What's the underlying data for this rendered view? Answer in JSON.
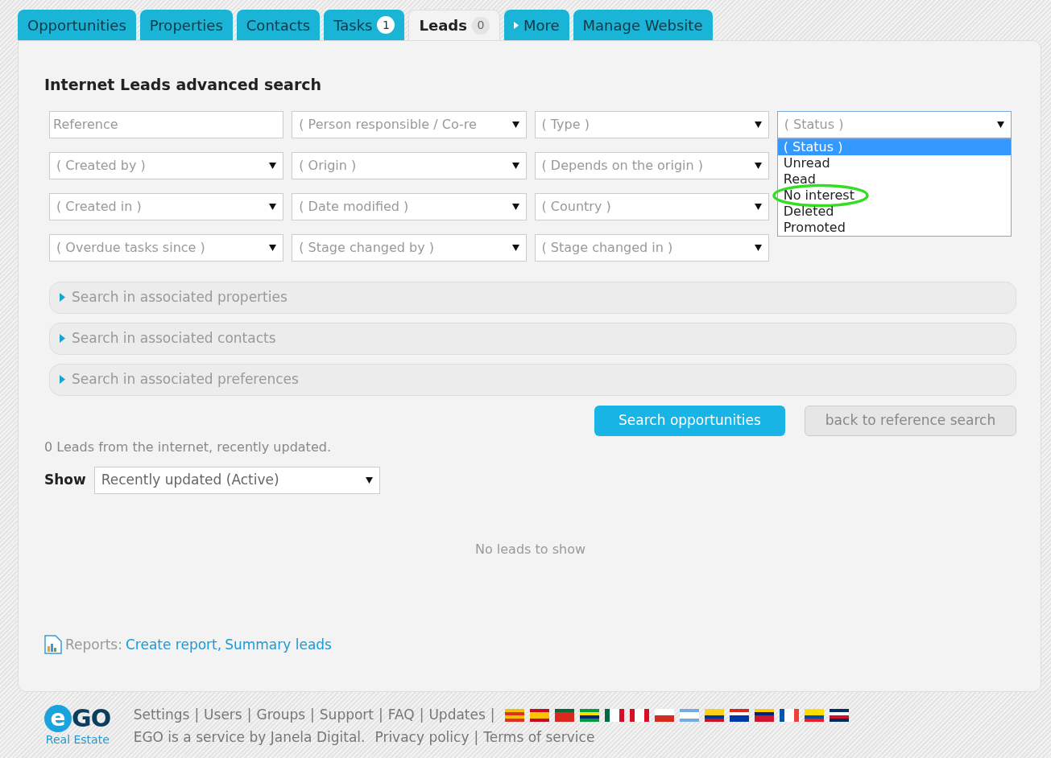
{
  "tabs": [
    {
      "label": "Opportunities",
      "selected": false,
      "kind": "plain"
    },
    {
      "label": "Properties",
      "selected": false,
      "kind": "plain"
    },
    {
      "label": "Contacts",
      "selected": false,
      "kind": "plain"
    },
    {
      "label": "Tasks",
      "badge": "1",
      "selected": false,
      "kind": "plain"
    },
    {
      "label": "Leads",
      "badge": "0",
      "selected": true,
      "kind": "plain"
    },
    {
      "label": "More",
      "selected": false,
      "kind": "menu"
    },
    {
      "label": "Manage Website",
      "selected": false,
      "kind": "plain"
    }
  ],
  "heading": "Internet Leads advanced search",
  "filters": [
    {
      "kind": "text",
      "placeholder": "Reference"
    },
    {
      "kind": "select",
      "value": "( Person responsible / Co-re"
    },
    {
      "kind": "select",
      "value": "( Type )"
    },
    {
      "kind": "select",
      "value": "( Status )",
      "expanded": true,
      "options": [
        {
          "label": "( Status )",
          "selected": true,
          "circled": false
        },
        {
          "label": "Unread",
          "selected": false,
          "circled": false
        },
        {
          "label": "Read",
          "selected": false,
          "circled": false
        },
        {
          "label": "No interest",
          "selected": false,
          "circled": true
        },
        {
          "label": "Deleted",
          "selected": false,
          "circled": false
        },
        {
          "label": "Promoted",
          "selected": false,
          "circled": false
        }
      ]
    },
    {
      "kind": "select",
      "value": "( Created by )"
    },
    {
      "kind": "select",
      "value": "( Origin )"
    },
    {
      "kind": "select",
      "value": "( Depends on the origin )"
    },
    {
      "kind": "spacer"
    },
    {
      "kind": "select",
      "value": "( Created in )"
    },
    {
      "kind": "select",
      "value": "( Date modified )"
    },
    {
      "kind": "select",
      "value": "( Country )"
    },
    {
      "kind": "spacer"
    },
    {
      "kind": "select",
      "value": "( Overdue tasks since )"
    },
    {
      "kind": "select",
      "value": "( Stage changed by )"
    },
    {
      "kind": "select",
      "value": "( Stage changed in )"
    }
  ],
  "sections": [
    {
      "label": "Search in associated properties",
      "expanded": false
    },
    {
      "label": "Search in associated contacts",
      "expanded": false
    },
    {
      "label": "Search in associated preferences",
      "expanded": false
    }
  ],
  "buttons": [
    {
      "label": "Search opportunities",
      "kind": "primary"
    },
    {
      "label": "back to reference search",
      "kind": "secondary"
    }
  ],
  "summary": "0 Leads from the internet, recently updated.",
  "show": {
    "label": "Show",
    "value": "Recently updated (Active)"
  },
  "empty_message": "No leads to show",
  "reports": {
    "label": "Reports:",
    "links": [
      "Create report",
      "Summary leads"
    ],
    "separator": ","
  },
  "footer": {
    "logo": {
      "mark": "e",
      "name": "GO",
      "tagline": "Real Estate"
    },
    "links": [
      "Settings",
      "Users",
      "Groups",
      "Support",
      "FAQ",
      "Updates"
    ],
    "separator": "|",
    "credit": "EGO is a service by Janela Digital.",
    "legal_links": [
      "Privacy policy",
      "Terms of service"
    ]
  }
}
